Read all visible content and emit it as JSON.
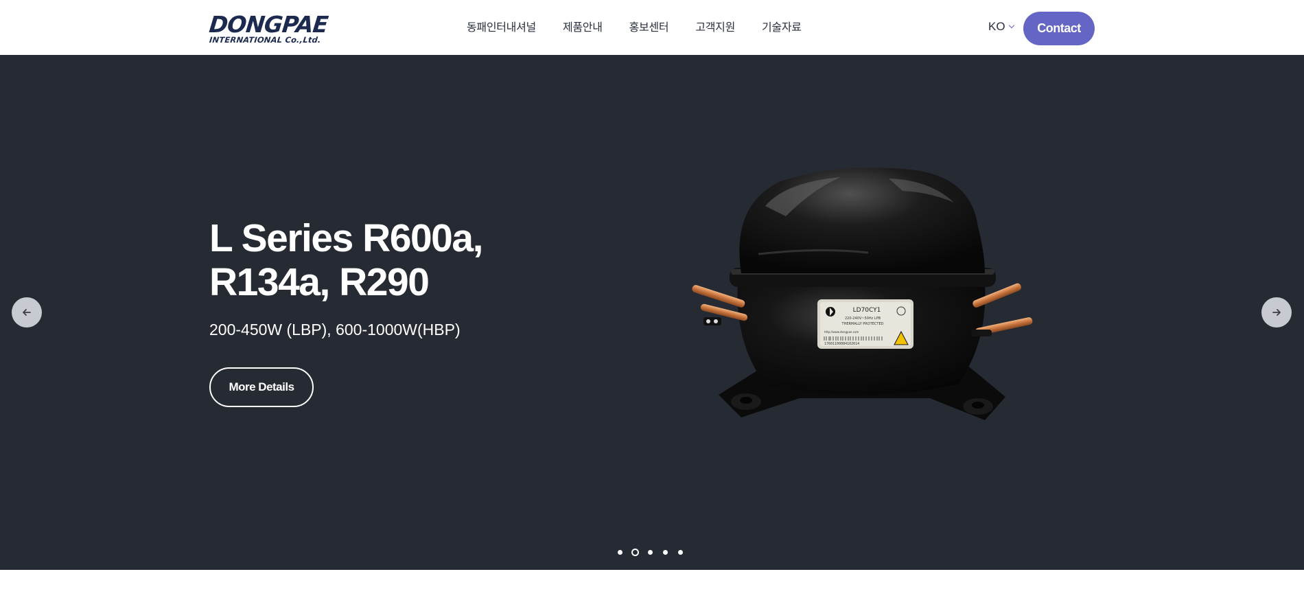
{
  "header": {
    "logo": {
      "main": "DONGPAE",
      "sub": "INTERNATIONAL Co.,Ltd."
    },
    "nav": [
      {
        "label": "동패인터내셔널"
      },
      {
        "label": "제품안내"
      },
      {
        "label": "홍보센터"
      },
      {
        "label": "고객지원"
      },
      {
        "label": "기술자료"
      }
    ],
    "language": "KO",
    "contact_label": "Contact",
    "accent_color": "#6465c4"
  },
  "hero": {
    "title_line1": "L Series R600a,",
    "title_line2": "R134a, R290",
    "subtitle": "200-450W (LBP), 600-1000W(HBP)",
    "details_label": "More Details",
    "product_label": {
      "model": "LD70CY1",
      "line1": "220-240V~50Hz  LPB",
      "line2": "THERMALLY PROTECTED",
      "url": "http://www.dongpae.com",
      "barcode": "17601100084102614"
    },
    "background_color": "#262a32",
    "slider": {
      "total": 5,
      "active_index": 2
    }
  },
  "icons": {
    "prev": "arrow-left-icon",
    "next": "arrow-right-icon",
    "lang": "chevron-down-icon"
  }
}
